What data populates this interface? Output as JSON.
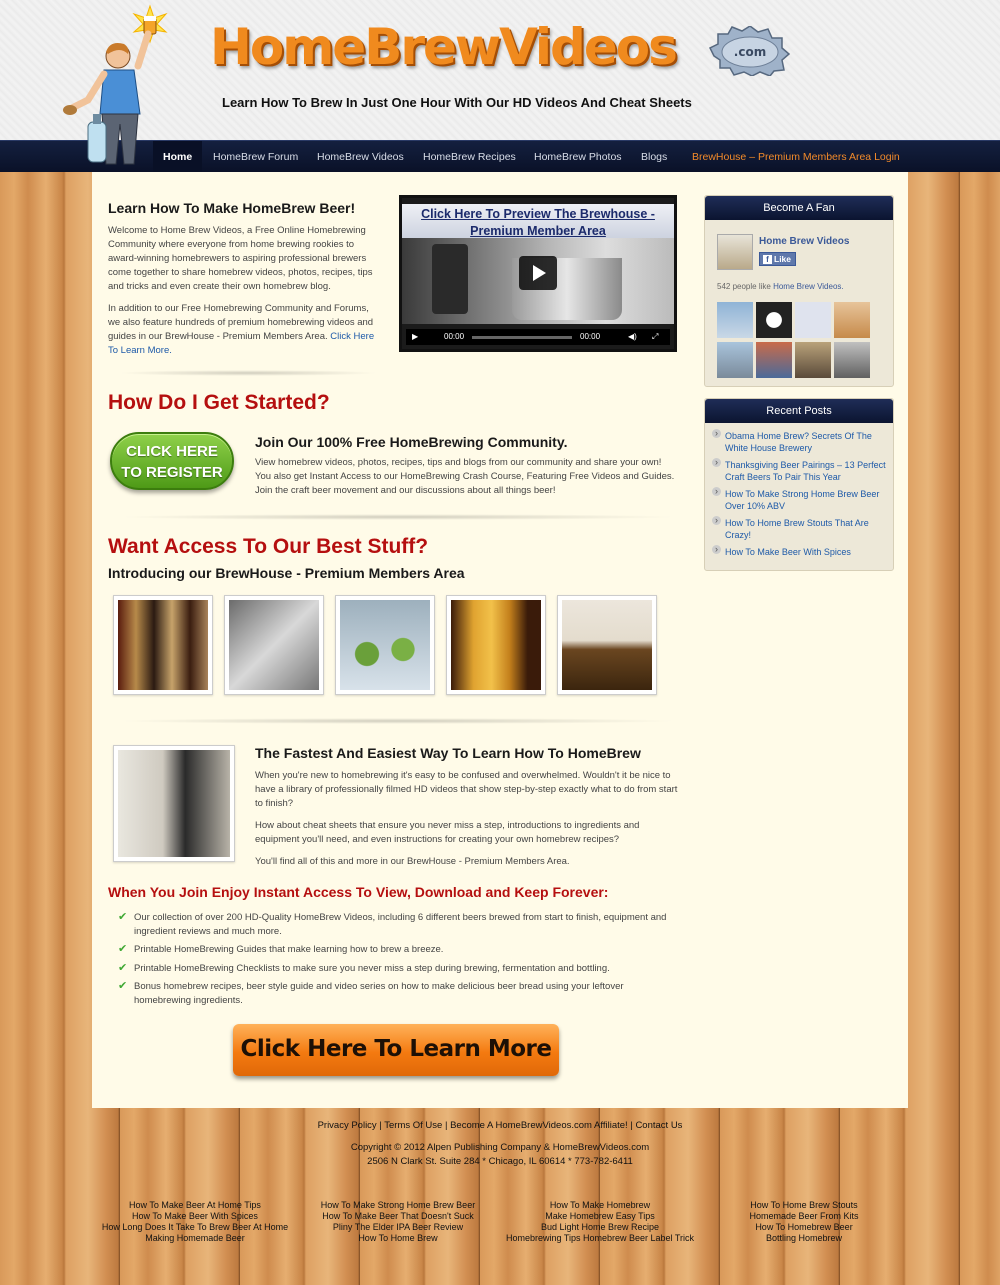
{
  "header": {
    "logo_text": "HomeBrewVideos",
    "cap_text": ".com",
    "tagline": "Learn How To Brew In Just One Hour With Our HD Videos And Cheat Sheets"
  },
  "nav": {
    "items": [
      {
        "label": "Home",
        "active": true
      },
      {
        "label": "HomeBrew Forum"
      },
      {
        "label": "HomeBrew Videos"
      },
      {
        "label": "HomeBrew Recipes"
      },
      {
        "label": "HomeBrew Photos"
      },
      {
        "label": "Blogs"
      },
      {
        "label": "BrewHouse – Premium Members Area Login",
        "accent": "#f28a2a"
      }
    ]
  },
  "intro": {
    "title": "Learn How To Make HomeBrew Beer!",
    "para1": "Welcome to Home Brew Videos, a Free Online Homebrewing Community where everyone from home brewing rookies to award-winning homebrewers to aspiring professional brewers come together to share homebrew videos, photos, recipes, tips and tricks and even create their own homebrew blog.",
    "para2": "In addition to our Free Homebrewing Community and Forums, we also feature hundreds of premium homebrewing videos and guides in our BrewHouse - Premium Members Area.",
    "para2_link": "Click Here To Learn More."
  },
  "video": {
    "title_line1": "Click Here To Preview The Brewhouse -",
    "title_line2": "Premium Member Area",
    "time_current": "00:00",
    "time_total": "00:00"
  },
  "get_started": {
    "heading": "How Do I Get Started?",
    "button_line1": "CLICK HERE",
    "button_line2": "TO REGISTER",
    "subheading": "Join Our 100% Free HomeBrewing Community.",
    "para": "View homebrew videos, photos, recipes, tips and blogs from our community and share your own! You also get Instant Access to our HomeBrewing Crash Course, Featuring Free Videos and Guides. Join the craft beer movement and our discussions about all things beer!"
  },
  "best_stuff": {
    "heading": "Want Access To Our Best Stuff?",
    "subheading": "Introducing our BrewHouse - Premium Members Area"
  },
  "fastest": {
    "heading": "The Fastest And Easiest Way To Learn How To HomeBrew",
    "para1": "When you're new to homebrewing it's easy to be confused and overwhelmed. Wouldn't it be nice to have a library of professionally filmed HD videos that show step-by-step exactly what to do from start to finish?",
    "para2": "How about cheat sheets that ensure you never miss a step, introductions to ingredients and equipment you'll need, and even instructions for creating your own homebrew recipes?",
    "para3": "You'll find all of this and more in our BrewHouse - Premium Members Area."
  },
  "join": {
    "heading": "When You Join Enjoy Instant Access To View, Download and Keep Forever:",
    "items": [
      "Our collection of over 200 HD-Quality HomeBrew Videos, including 6 different beers brewed from start to finish, equipment and ingredient reviews and much more.",
      "Printable HomeBrewing Guides that make learning how to brew a breeze.",
      "Printable HomeBrewing Checklists to make sure you never miss a step during brewing, fermentation and bottling.",
      "Bonus homebrew recipes, beer style guide and video series on how to make delicious beer bread using your leftover homebrewing ingredients."
    ],
    "cta": "Click Here To Learn More"
  },
  "sidebar": {
    "fan": {
      "title": "Become A Fan",
      "page_name": "Home Brew Videos",
      "like_label": "Like",
      "likes_text": "542 people like",
      "likes_link": "Home Brew Videos."
    },
    "recent": {
      "title": "Recent Posts",
      "items": [
        "Obama Home Brew? Secrets Of The White House Brewery",
        "Thanksgiving Beer Pairings – 13 Perfect Craft Beers To Pair This Year",
        "How To Make Strong Home Brew Beer Over 10% ABV",
        "How To Home Brew Stouts That Are Crazy!",
        "How To Make Beer With Spices"
      ]
    }
  },
  "footer": {
    "links": [
      "Privacy Policy",
      "Terms Of Use",
      "Become A HomeBrewVideos.com Affiliate!",
      "Contact Us"
    ],
    "copyright": "Copyright © 2012 Alpen Publishing Company & HomeBrewVideos.com",
    "address": "2506 N Clark St. Suite 284 * Chicago, IL 60614 * 773-782-6411",
    "columns": [
      [
        "How To Make Beer At Home Tips",
        "How To Make Beer With Spices",
        "How Long Does It Take To Brew Beer At Home",
        "Making Homemade Beer"
      ],
      [
        "How To Make Strong Home Brew Beer",
        "How To Make Beer That Doesn't Suck",
        "Pliny The Elder IPA Beer Review",
        "How To Home Brew"
      ],
      [
        "How To Make Homebrew",
        "Make Homebrew Easy Tips",
        "Bud Light Home Brew Recipe",
        "Homebrewing Tips Homebrew Beer Label Trick"
      ],
      [
        "How To Home Brew Stouts",
        "Homemade Beer From Kits",
        "How To Homebrew Beer",
        "Bottling Homebrew"
      ]
    ]
  }
}
